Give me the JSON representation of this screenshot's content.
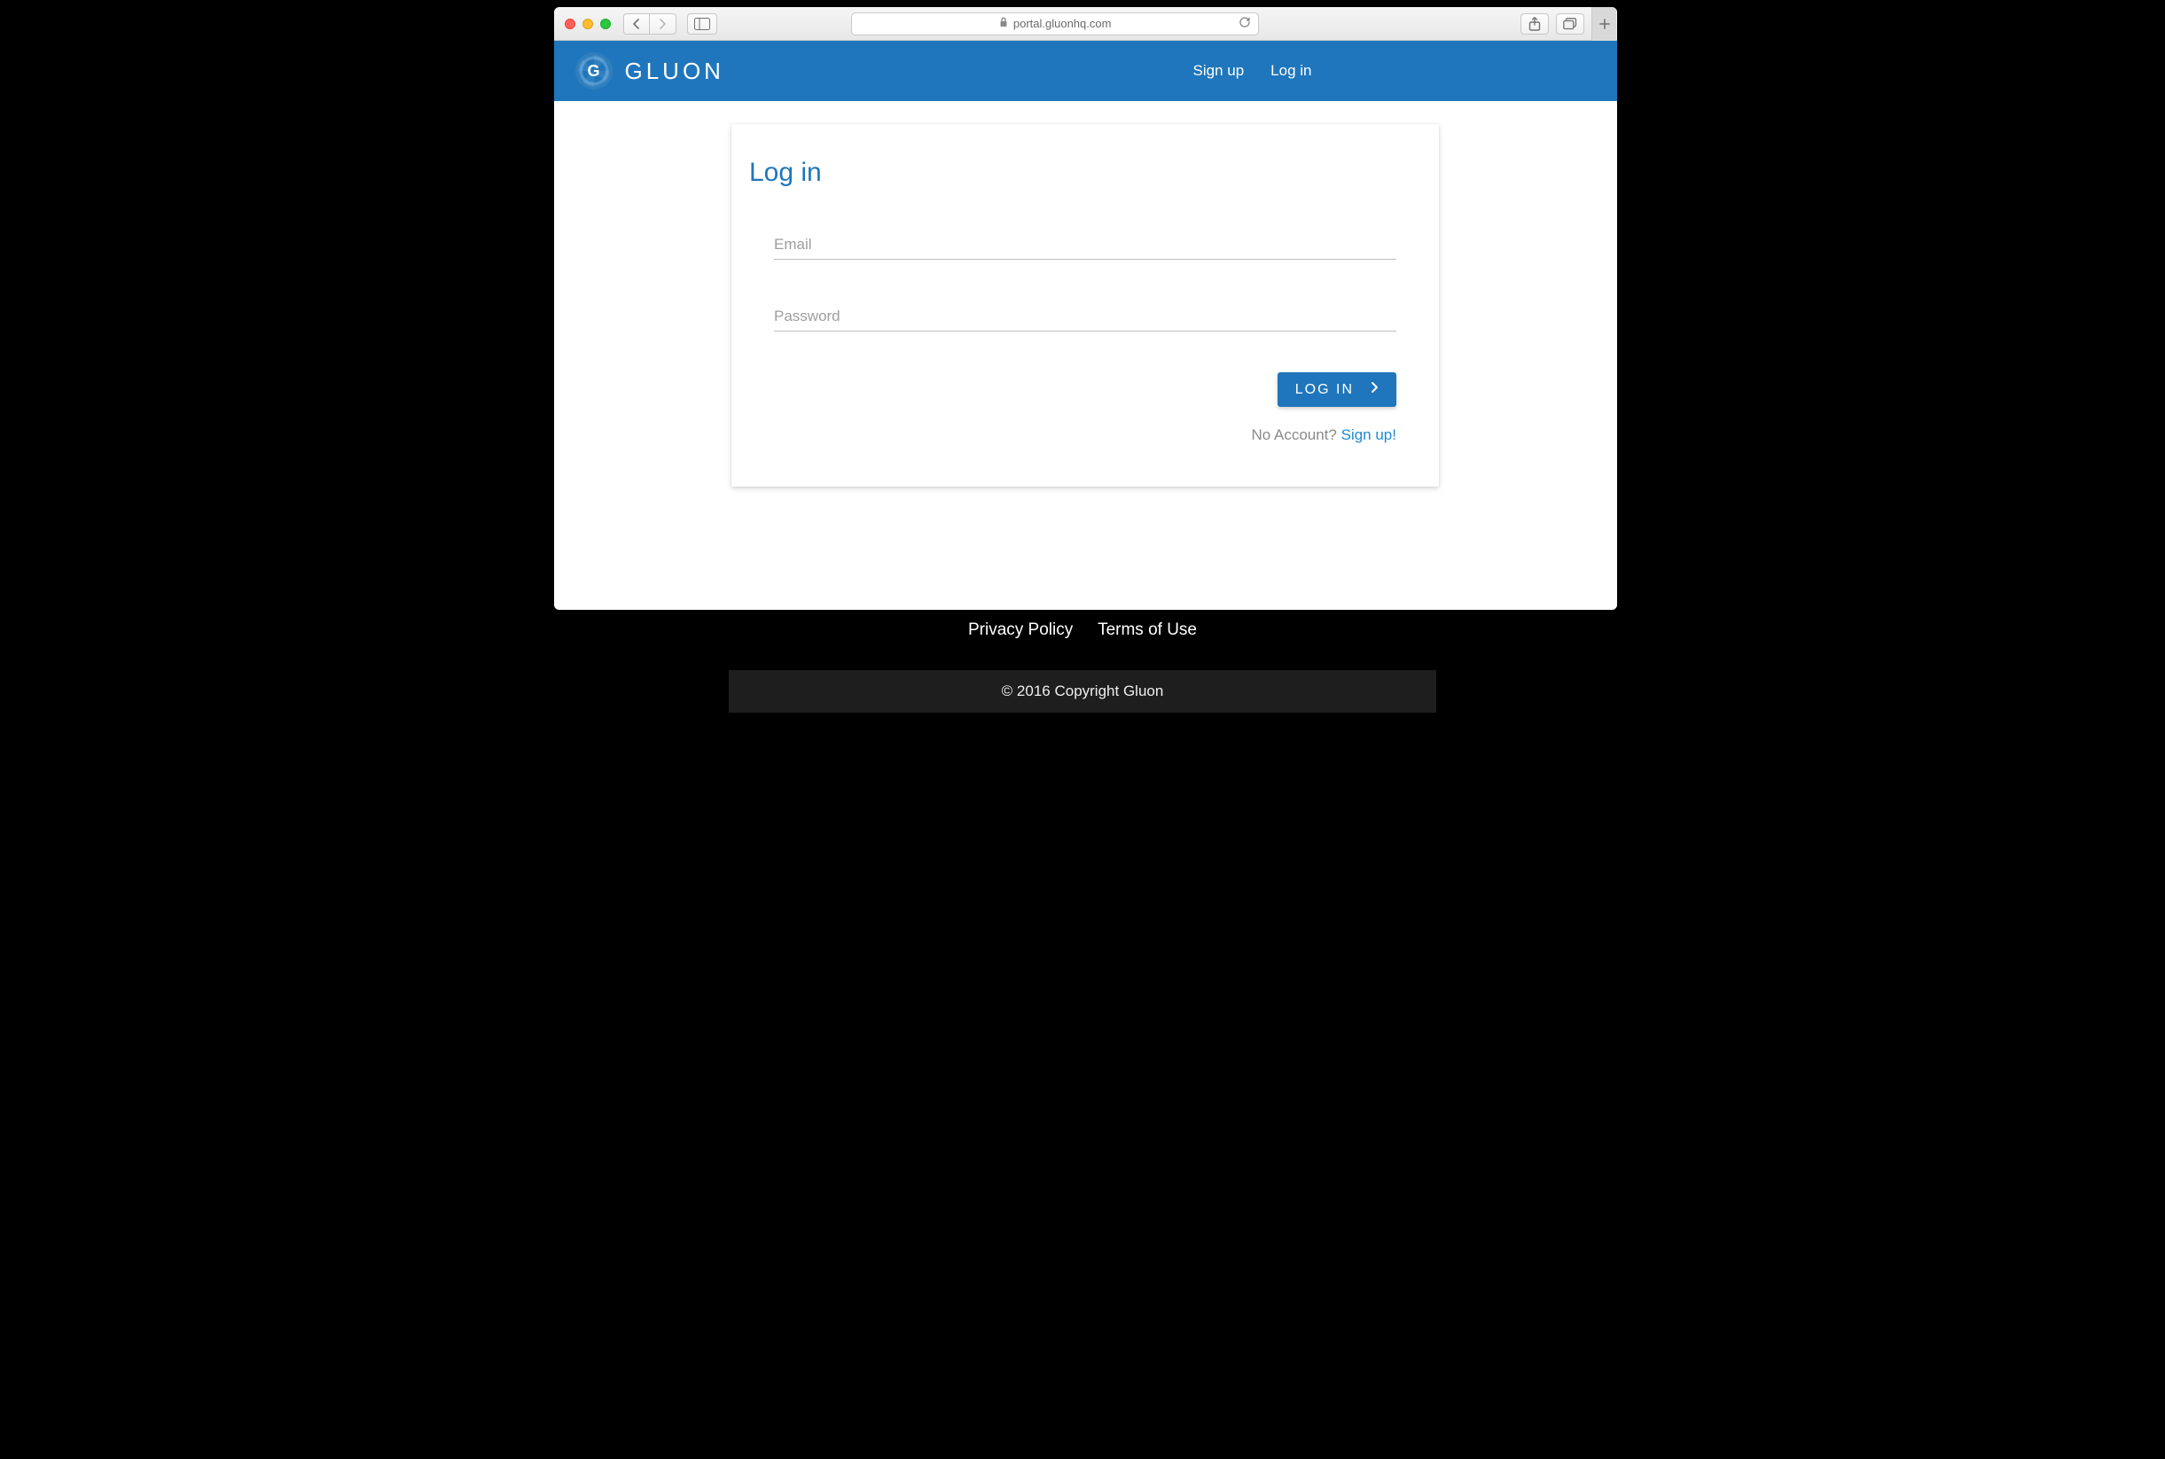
{
  "browser": {
    "url_host": "portal.gluonhq.com"
  },
  "header": {
    "brand_letter": "G",
    "brand_word": "GLUON",
    "nav": {
      "signup": "Sign up",
      "login": "Log in"
    }
  },
  "card": {
    "title": "Log in",
    "email_placeholder": "Email",
    "password_placeholder": "Password",
    "login_button": "LOG IN",
    "no_account_text": "No Account? ",
    "signup_link": "Sign up!"
  },
  "footer": {
    "privacy": "Privacy Policy",
    "terms": "Terms of Use",
    "copyright": "© 2016 Copyright Gluon"
  }
}
